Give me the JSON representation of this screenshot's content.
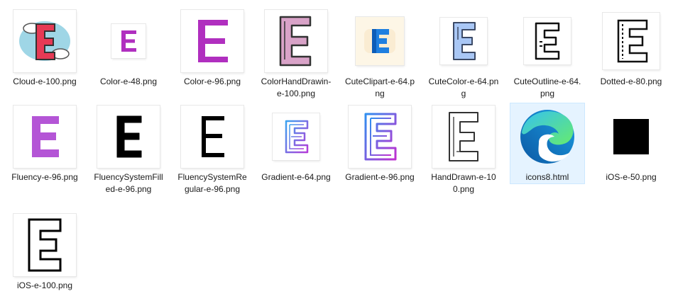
{
  "files": [
    {
      "name": "Cloud-e-100.png",
      "icon": "cloud-e-icon"
    },
    {
      "name": "Color-e-48.png",
      "icon": "color-e-small-icon"
    },
    {
      "name": "Color-e-96.png",
      "icon": "color-e-icon"
    },
    {
      "name": "ColorHandDrawin-e-100.png",
      "icon": "color-hand-drawn-e-icon"
    },
    {
      "name": "CuteClipart-e-64.png",
      "icon": "cute-clipart-e-icon"
    },
    {
      "name": "CuteColor-e-64.png",
      "icon": "cute-color-e-icon"
    },
    {
      "name": "CuteOutline-e-64.png",
      "icon": "cute-outline-e-icon"
    },
    {
      "name": "Dotted-e-80.png",
      "icon": "dotted-e-icon"
    },
    {
      "name": "Fluency-e-96.png",
      "icon": "fluency-e-icon"
    },
    {
      "name": "FluencySystemFilled-e-96.png",
      "icon": "fluency-system-filled-e-icon"
    },
    {
      "name": "FluencySystemRegular-e-96.png",
      "icon": "fluency-system-regular-e-icon"
    },
    {
      "name": "Gradient-e-64.png",
      "icon": "gradient-e-small-icon"
    },
    {
      "name": "Gradient-e-96.png",
      "icon": "gradient-e-icon"
    },
    {
      "name": "HandDrawn-e-100.png",
      "icon": "hand-drawn-e-icon"
    },
    {
      "name": "icons8.html",
      "icon": "edge-browser-icon",
      "selected": true
    },
    {
      "name": "iOS-e-50.png",
      "icon": "ios-e-small-icon"
    },
    {
      "name": "iOS-e-100.png",
      "icon": "ios-e-icon"
    }
  ],
  "colors": {
    "magenta": "#b02fbf",
    "fluency_purple": "#b455d6",
    "cloud_red": "#e63a55",
    "cloud_blue": "#9fd6e6",
    "clipart_blue": "#1e7fe0",
    "cute_blue": "#a9c7f5",
    "hand_pink": "#d9a3c8",
    "selection": "#e5f3ff"
  }
}
